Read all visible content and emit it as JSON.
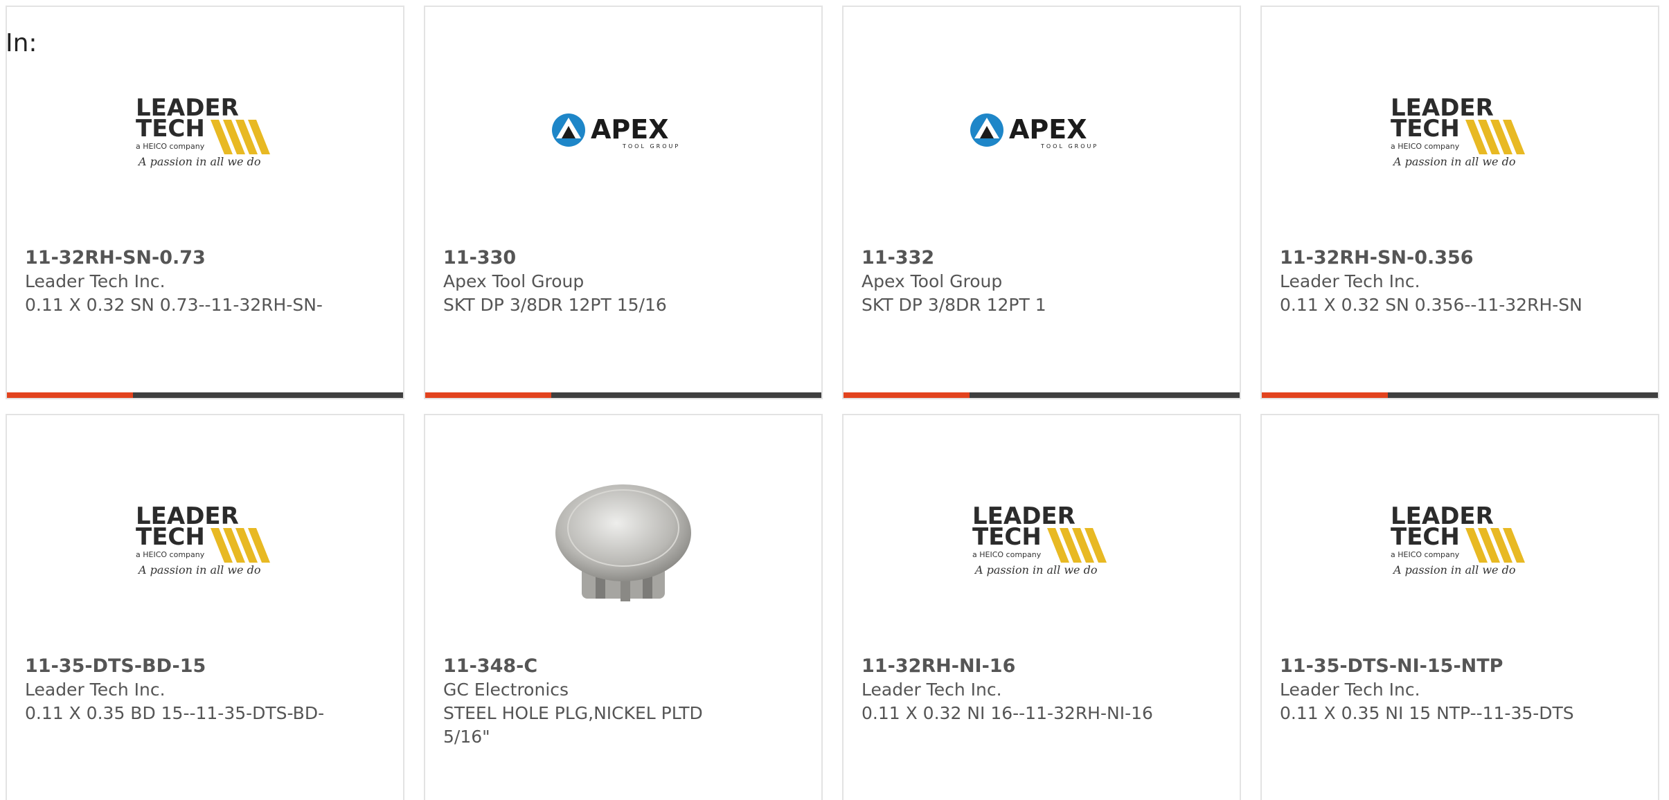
{
  "header": {
    "in_label": "In:"
  },
  "products": [
    {
      "part_number": "11-32RH-SN-0.73",
      "manufacturer": "Leader Tech Inc.",
      "description": "0.11 X 0.32 SN 0.73--11-32RH-SN-",
      "image": "leader-tech-logo",
      "has_bar": true
    },
    {
      "part_number": "11-330",
      "manufacturer": "Apex Tool Group",
      "description": "SKT DP 3/8DR 12PT 15/16",
      "image": "apex-logo",
      "has_bar": true
    },
    {
      "part_number": "11-332",
      "manufacturer": "Apex Tool Group",
      "description": "SKT DP 3/8DR 12PT 1",
      "image": "apex-logo",
      "has_bar": true
    },
    {
      "part_number": "11-32RH-SN-0.356",
      "manufacturer": "Leader Tech Inc.",
      "description": "0.11 X 0.32 SN 0.356--11-32RH-SN",
      "image": "leader-tech-logo",
      "has_bar": true
    },
    {
      "part_number": "11-35-DTS-BD-15",
      "manufacturer": "Leader Tech Inc.",
      "description": "0.11 X 0.35 BD 15--11-35-DTS-BD-",
      "image": "leader-tech-logo",
      "has_bar": false
    },
    {
      "part_number": "11-348-C",
      "manufacturer": "GC Electronics",
      "description": "STEEL HOLE PLG,NICKEL PLTD 5/16\"",
      "image": "hole-plug-photo",
      "has_bar": false
    },
    {
      "part_number": "11-32RH-NI-16",
      "manufacturer": "Leader Tech Inc.",
      "description": "0.11 X 0.32 NI 16--11-32RH-NI-16",
      "image": "leader-tech-logo",
      "has_bar": false
    },
    {
      "part_number": "11-35-DTS-NI-15-NTP",
      "manufacturer": "Leader Tech Inc.",
      "description": "0.11 X 0.35 NI 15 NTP--11-35-DTS",
      "image": "leader-tech-logo",
      "has_bar": false
    }
  ],
  "logo_text": {
    "leader": "LEADER",
    "tech": "TECH",
    "heico": "a HEICO company",
    "tagline": "A passion in all we do",
    "apex": "APEX",
    "apex_sub": "TOOL GROUP"
  },
  "colors": {
    "accent": "#e2431e",
    "bar": "#3f3f3f",
    "logo_gold": "#e8b923",
    "text": "#555555"
  }
}
